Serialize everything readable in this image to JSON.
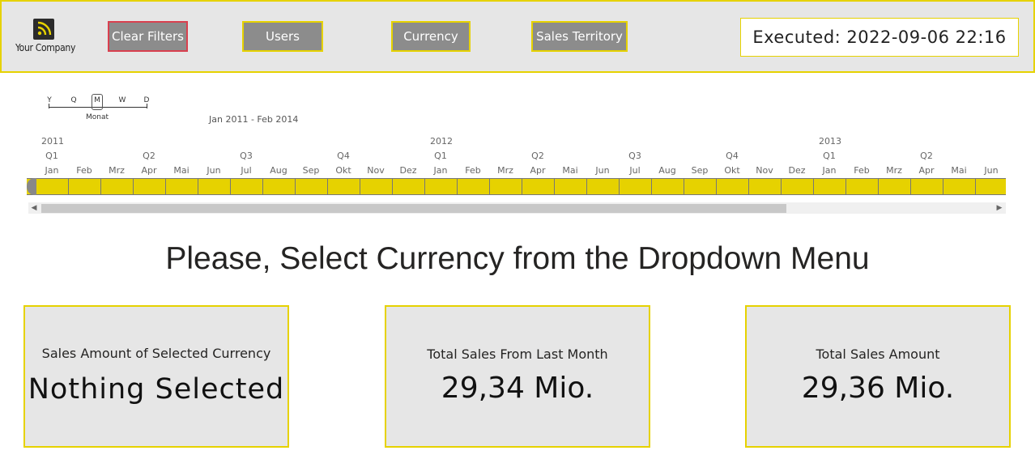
{
  "header": {
    "logo_text": "Your Company",
    "buttons": {
      "clear_filters": "Clear Filters",
      "users": "Users",
      "currency": "Currency",
      "sales_territory": "Sales Territory"
    },
    "executed": "Executed: 2022-09-06 22:16"
  },
  "timeline": {
    "granularity": [
      "Y",
      "Q",
      "M",
      "W",
      "D"
    ],
    "granularity_selected": "M",
    "granularity_label": "Monat",
    "range_label": "Jan 2011 - Feb 2014",
    "years": [
      "2011",
      "2012",
      "2013"
    ],
    "quarters": [
      "Q1",
      "Q2",
      "Q3",
      "Q4",
      "Q1",
      "Q2",
      "Q3",
      "Q4",
      "Q1",
      "Q2"
    ],
    "months": [
      "Jan",
      "Feb",
      "Mrz",
      "Apr",
      "Mai",
      "Jun",
      "Jul",
      "Aug",
      "Sep",
      "Okt",
      "Nov",
      "Dez",
      "Jan",
      "Feb",
      "Mrz",
      "Apr",
      "Mai",
      "Jun",
      "Jul",
      "Aug",
      "Sep",
      "Okt",
      "Nov",
      "Dez",
      "Jan",
      "Feb",
      "Mrz",
      "Apr",
      "Mai",
      "Jun"
    ]
  },
  "headline": "Please, Select Currency from the Dropdown Menu",
  "cards": [
    {
      "label": "Sales Amount of Selected Currency",
      "value": "Nothing Selected"
    },
    {
      "label": "Total Sales From Last Month",
      "value": "29,34 Mio."
    },
    {
      "label": "Total Sales Amount",
      "value": "29,36 Mio."
    }
  ],
  "colors": {
    "accent": "#e6d200",
    "button_bg": "#8c8c8c",
    "clear_button_border": "#d9404f",
    "panel_bg": "#e6e6e6"
  },
  "icons": {
    "logo": "rss-icon",
    "scroll_left": "caret-left-icon",
    "scroll_right": "caret-right-icon"
  }
}
